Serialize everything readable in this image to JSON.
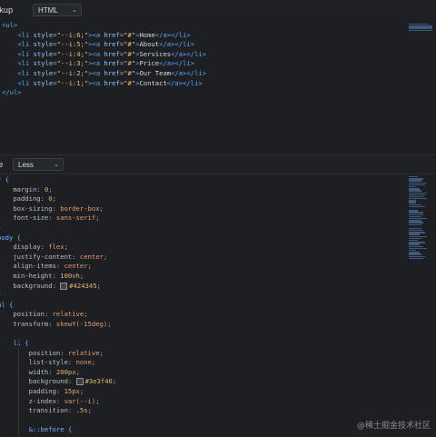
{
  "markup_pane": {
    "label": "rkup",
    "language": "HTML",
    "lines": [
      [
        {
          "t": "<ul>",
          "c": "tag"
        }
      ],
      [
        {
          "t": "    "
        },
        {
          "t": "<li",
          "c": "tag"
        },
        {
          "t": " style",
          "c": "attr"
        },
        {
          "t": "=",
          "c": "punc"
        },
        {
          "t": "\"--i:6;\"",
          "c": "str"
        },
        {
          "t": "><",
          "c": "tag"
        },
        {
          "t": "a",
          "c": "tag"
        },
        {
          "t": " href",
          "c": "attr"
        },
        {
          "t": "=",
          "c": "punc"
        },
        {
          "t": "\"#\"",
          "c": "str"
        },
        {
          "t": ">",
          "c": "tag"
        },
        {
          "t": "Home",
          "c": "txt"
        },
        {
          "t": "</a></li>",
          "c": "tag"
        }
      ],
      [
        {
          "t": "    "
        },
        {
          "t": "<li",
          "c": "tag"
        },
        {
          "t": " style",
          "c": "attr"
        },
        {
          "t": "=",
          "c": "punc"
        },
        {
          "t": "\"--i:5;\"",
          "c": "str"
        },
        {
          "t": "><",
          "c": "tag"
        },
        {
          "t": "a",
          "c": "tag"
        },
        {
          "t": " href",
          "c": "attr"
        },
        {
          "t": "=",
          "c": "punc"
        },
        {
          "t": "\"#\"",
          "c": "str"
        },
        {
          "t": ">",
          "c": "tag"
        },
        {
          "t": "About",
          "c": "txt"
        },
        {
          "t": "</a></li>",
          "c": "tag"
        }
      ],
      [
        {
          "t": "    "
        },
        {
          "t": "<li",
          "c": "tag"
        },
        {
          "t": " style",
          "c": "attr"
        },
        {
          "t": "=",
          "c": "punc"
        },
        {
          "t": "\"--i:4;\"",
          "c": "str"
        },
        {
          "t": "><",
          "c": "tag"
        },
        {
          "t": "a",
          "c": "tag"
        },
        {
          "t": " href",
          "c": "attr"
        },
        {
          "t": "=",
          "c": "punc"
        },
        {
          "t": "\"#\"",
          "c": "str"
        },
        {
          "t": ">",
          "c": "tag"
        },
        {
          "t": "Services",
          "c": "txt"
        },
        {
          "t": "</a></li>",
          "c": "tag"
        }
      ],
      [
        {
          "t": "    "
        },
        {
          "t": "<li",
          "c": "tag"
        },
        {
          "t": " style",
          "c": "attr"
        },
        {
          "t": "=",
          "c": "punc"
        },
        {
          "t": "\"--i:3;\"",
          "c": "str"
        },
        {
          "t": "><",
          "c": "tag"
        },
        {
          "t": "a",
          "c": "tag"
        },
        {
          "t": " href",
          "c": "attr"
        },
        {
          "t": "=",
          "c": "punc"
        },
        {
          "t": "\"#\"",
          "c": "str"
        },
        {
          "t": ">",
          "c": "tag"
        },
        {
          "t": "Price",
          "c": "txt"
        },
        {
          "t": "</a></li>",
          "c": "tag"
        }
      ],
      [
        {
          "t": "    "
        },
        {
          "t": "<li",
          "c": "tag"
        },
        {
          "t": " style",
          "c": "attr"
        },
        {
          "t": "=",
          "c": "punc"
        },
        {
          "t": "\"--i:2;\"",
          "c": "str"
        },
        {
          "t": "><",
          "c": "tag"
        },
        {
          "t": "a",
          "c": "tag"
        },
        {
          "t": " href",
          "c": "attr"
        },
        {
          "t": "=",
          "c": "punc"
        },
        {
          "t": "\"#\"",
          "c": "str"
        },
        {
          "t": ">",
          "c": "tag"
        },
        {
          "t": "Our Team",
          "c": "txt"
        },
        {
          "t": "</a></li>",
          "c": "tag"
        }
      ],
      [
        {
          "t": "    "
        },
        {
          "t": "<li",
          "c": "tag"
        },
        {
          "t": " style",
          "c": "attr"
        },
        {
          "t": "=",
          "c": "punc"
        },
        {
          "t": "\"--i:1;\"",
          "c": "str"
        },
        {
          "t": "><",
          "c": "tag"
        },
        {
          "t": "a",
          "c": "tag"
        },
        {
          "t": " href",
          "c": "attr"
        },
        {
          "t": "=",
          "c": "punc"
        },
        {
          "t": "\"#\"",
          "c": "str"
        },
        {
          "t": ">",
          "c": "tag"
        },
        {
          "t": "Contact",
          "c": "txt"
        },
        {
          "t": "</a></li>",
          "c": "tag"
        }
      ],
      [
        {
          "t": "</ul>",
          "c": "tag"
        }
      ]
    ]
  },
  "style_pane": {
    "label": "le",
    "language": "Less",
    "lines": [
      [
        {
          "t": "* {",
          "c": "sel"
        }
      ],
      [
        {
          "t": "    "
        },
        {
          "t": "margin",
          "c": "prop"
        },
        {
          "t": ": ",
          "c": "punc"
        },
        {
          "t": "0",
          "c": "num"
        },
        {
          "t": ";",
          "c": "punc"
        }
      ],
      [
        {
          "t": "    "
        },
        {
          "t": "padding",
          "c": "prop"
        },
        {
          "t": ": ",
          "c": "punc"
        },
        {
          "t": "0",
          "c": "num"
        },
        {
          "t": ";",
          "c": "punc"
        }
      ],
      [
        {
          "t": "    "
        },
        {
          "t": "box-sizing",
          "c": "prop"
        },
        {
          "t": ": ",
          "c": "punc"
        },
        {
          "t": "border-box",
          "c": "val"
        },
        {
          "t": ";",
          "c": "punc"
        }
      ],
      [
        {
          "t": "    "
        },
        {
          "t": "font-size",
          "c": "prop"
        },
        {
          "t": ": ",
          "c": "punc"
        },
        {
          "t": "sans-serif",
          "c": "val"
        },
        {
          "t": ";",
          "c": "punc"
        }
      ],
      [
        {
          "t": "}",
          "c": "sel"
        }
      ],
      [
        {
          "t": "body {",
          "c": "sel"
        }
      ],
      [
        {
          "t": "    "
        },
        {
          "t": "display",
          "c": "prop"
        },
        {
          "t": ": ",
          "c": "punc"
        },
        {
          "t": "flex",
          "c": "val"
        },
        {
          "t": ";",
          "c": "punc"
        }
      ],
      [
        {
          "t": "    "
        },
        {
          "t": "justify-content",
          "c": "prop"
        },
        {
          "t": ": ",
          "c": "punc"
        },
        {
          "t": "center",
          "c": "val"
        },
        {
          "t": ";",
          "c": "punc"
        }
      ],
      [
        {
          "t": "    "
        },
        {
          "t": "align-items",
          "c": "prop"
        },
        {
          "t": ": ",
          "c": "punc"
        },
        {
          "t": "center",
          "c": "val"
        },
        {
          "t": ";",
          "c": "punc"
        }
      ],
      [
        {
          "t": "    "
        },
        {
          "t": "min-height",
          "c": "prop"
        },
        {
          "t": ": ",
          "c": "punc"
        },
        {
          "t": "100vh",
          "c": "num"
        },
        {
          "t": ";",
          "c": "punc"
        }
      ],
      [
        {
          "t": "    "
        },
        {
          "t": "background",
          "c": "prop"
        },
        {
          "t": ": ",
          "c": "punc"
        },
        {
          "sw": "#424345"
        },
        {
          "t": "#424345",
          "c": "num"
        },
        {
          "t": ";",
          "c": "punc"
        }
      ],
      [
        {
          "t": "}",
          "c": "sel"
        }
      ],
      [
        {
          "t": "ul {",
          "c": "sel"
        }
      ],
      [
        {
          "t": "    "
        },
        {
          "t": "position",
          "c": "prop"
        },
        {
          "t": ": ",
          "c": "punc"
        },
        {
          "t": "relative",
          "c": "val"
        },
        {
          "t": ";",
          "c": "punc"
        }
      ],
      [
        {
          "t": "    "
        },
        {
          "t": "transform",
          "c": "prop"
        },
        {
          "t": ": ",
          "c": "punc"
        },
        {
          "t": "skewY(-15deg)",
          "c": "val"
        },
        {
          "t": ";",
          "c": "punc"
        }
      ],
      [
        {
          "t": ""
        }
      ],
      [
        {
          "t": "    "
        },
        {
          "t": "li {",
          "c": "sel"
        }
      ],
      [
        {
          "t": "        "
        },
        {
          "t": "position",
          "c": "prop"
        },
        {
          "t": ": ",
          "c": "punc"
        },
        {
          "t": "relative",
          "c": "val"
        },
        {
          "t": ";",
          "c": "punc"
        }
      ],
      [
        {
          "t": "        "
        },
        {
          "t": "list-style",
          "c": "prop"
        },
        {
          "t": ": ",
          "c": "punc"
        },
        {
          "t": "none",
          "c": "val"
        },
        {
          "t": ";",
          "c": "punc"
        }
      ],
      [
        {
          "t": "        "
        },
        {
          "t": "width",
          "c": "prop"
        },
        {
          "t": ": ",
          "c": "punc"
        },
        {
          "t": "200px",
          "c": "num"
        },
        {
          "t": ";",
          "c": "punc"
        }
      ],
      [
        {
          "t": "        "
        },
        {
          "t": "background",
          "c": "prop"
        },
        {
          "t": ": ",
          "c": "punc"
        },
        {
          "sw": "#3e3f46"
        },
        {
          "t": "#3e3f46",
          "c": "num"
        },
        {
          "t": ";",
          "c": "punc"
        }
      ],
      [
        {
          "t": "        "
        },
        {
          "t": "padding",
          "c": "prop"
        },
        {
          "t": ": ",
          "c": "punc"
        },
        {
          "t": "15px",
          "c": "num"
        },
        {
          "t": ";",
          "c": "punc"
        }
      ],
      [
        {
          "t": "        "
        },
        {
          "t": "z-index",
          "c": "prop"
        },
        {
          "t": ": ",
          "c": "punc"
        },
        {
          "t": "var(--i)",
          "c": "val"
        },
        {
          "t": ";",
          "c": "punc"
        }
      ],
      [
        {
          "t": "        "
        },
        {
          "t": "transition",
          "c": "prop"
        },
        {
          "t": ": ",
          "c": "punc"
        },
        {
          "t": ".5s",
          "c": "num"
        },
        {
          "t": ";",
          "c": "punc"
        }
      ],
      [
        {
          "t": ""
        }
      ],
      [
        {
          "t": "        "
        },
        {
          "t": "&::before {",
          "c": "sel"
        }
      ]
    ]
  },
  "watermark": "@稀土掘金技术社区"
}
